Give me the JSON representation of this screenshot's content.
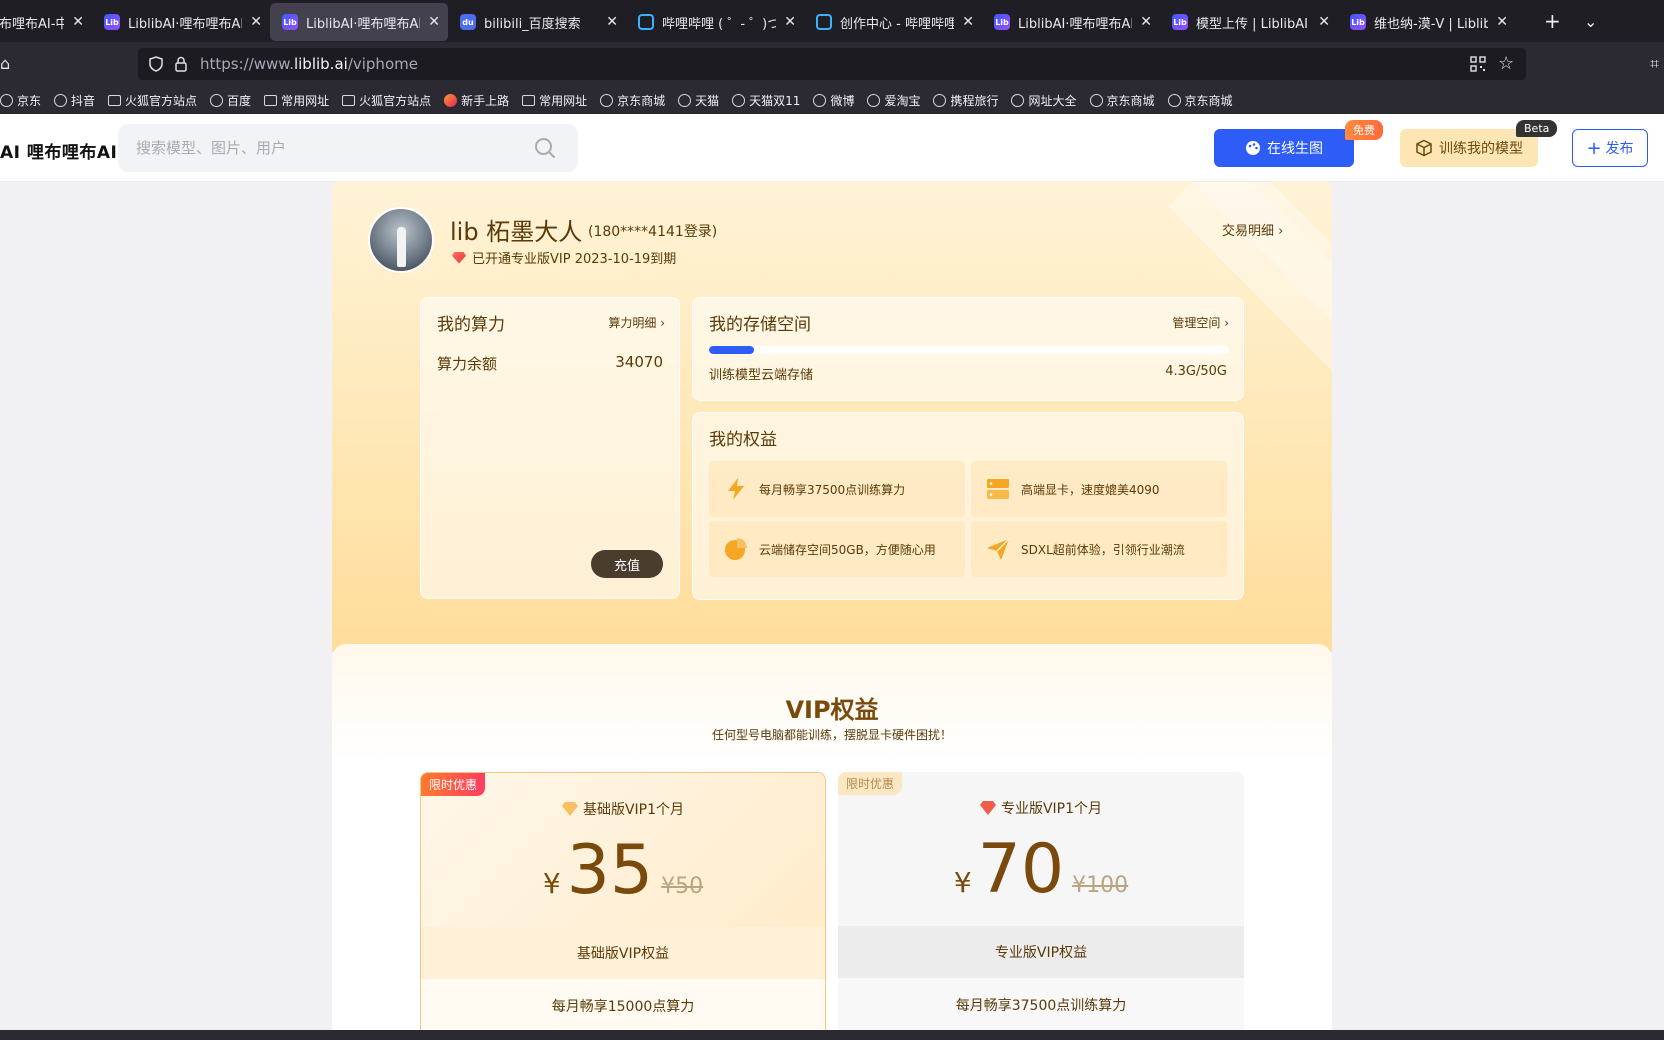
{
  "browser": {
    "tabs": [
      {
        "title": "哩布哩布AI-中",
        "icon": "liblib",
        "active": false
      },
      {
        "title": "LiblibAI·哩布哩布AI - 中",
        "icon": "liblib",
        "active": false
      },
      {
        "title": "LiblibAI·哩布哩布AI - 中",
        "icon": "liblib",
        "active": true
      },
      {
        "title": "bilibili_百度搜索",
        "icon": "baidu",
        "active": false
      },
      {
        "title": "哔哩哔哩 ( ゜- ゜)つロ 干",
        "icon": "bilibili",
        "active": false
      },
      {
        "title": "创作中心 - 哔哩哔哩弹",
        "icon": "bilibili",
        "active": false
      },
      {
        "title": "LiblibAI·哩布哩布AI - 中",
        "icon": "liblib",
        "active": false
      },
      {
        "title": "模型上传 | LiblibAI",
        "icon": "liblib",
        "active": false
      },
      {
        "title": "维也纳-漠-V | LiblibAI",
        "icon": "liblib",
        "active": false
      }
    ],
    "new_tab_symbol": "+",
    "tab_list_symbol": "⌄",
    "url": {
      "prefix": "https://www.",
      "domain": "liblib.ai",
      "path": "/viphome"
    },
    "bookmarks": [
      {
        "label": "京东",
        "icon": "globe"
      },
      {
        "label": "抖音",
        "icon": "globe"
      },
      {
        "label": "火狐官方站点",
        "icon": "folder"
      },
      {
        "label": "百度",
        "icon": "globe"
      },
      {
        "label": "常用网址",
        "icon": "folder"
      },
      {
        "label": "火狐官方站点",
        "icon": "folder"
      },
      {
        "label": "新手上路",
        "icon": "firefox"
      },
      {
        "label": "常用网址",
        "icon": "folder"
      },
      {
        "label": "京东商城",
        "icon": "globe"
      },
      {
        "label": "天猫",
        "icon": "globe"
      },
      {
        "label": "天猫双11",
        "icon": "globe"
      },
      {
        "label": "微博",
        "icon": "globe"
      },
      {
        "label": "爱淘宝",
        "icon": "globe"
      },
      {
        "label": "携程旅行",
        "icon": "globe"
      },
      {
        "label": "网址大全",
        "icon": "globe"
      },
      {
        "label": "京东商城",
        "icon": "globe"
      },
      {
        "label": "京东商城",
        "icon": "globe"
      }
    ]
  },
  "header": {
    "logo": "AI 哩布哩布AI",
    "search_placeholder": "搜索模型、图片、用户",
    "online_button": "在线生图",
    "free_badge": "免费",
    "train_button": "训练我的模型",
    "beta_badge": "Beta",
    "publish_button": "发布"
  },
  "profile": {
    "name": "lib 柘墨大人",
    "phone": "(180****4141登录)",
    "vip_status": "已开通专业版VIP  2023-10-19到期",
    "trade_link": "交易明细"
  },
  "compute": {
    "title": "我的算力",
    "link": "算力明细",
    "balance_label": "算力余额",
    "balance_value": "34070",
    "recharge": "充值"
  },
  "storage": {
    "title": "我的存储空间",
    "link": "管理空间",
    "label": "训练模型云端存储",
    "value": "4.3G/50G",
    "used_fraction": 0.086
  },
  "rights": {
    "title": "我的权益",
    "items": [
      {
        "text": "每月畅享37500点训练算力",
        "icon": "lightning-icon"
      },
      {
        "text": "高端显卡，速度媲美4090",
        "icon": "server-icon"
      },
      {
        "text": "云端储存空间50GB，方便随心用",
        "icon": "pie-chart-icon"
      },
      {
        "text": "SDXL超前体验，引领行业潮流",
        "icon": "paper-plane-icon"
      }
    ]
  },
  "vip_section": {
    "heading": "VIP权益",
    "subheading": "任何型号电脑都能训练，摆脱显卡硬件困扰！",
    "plans": [
      {
        "tag": "限时优惠",
        "name": "基础版VIP1个月",
        "currency": "¥",
        "price": "35",
        "original": "¥50",
        "band": "基础版VIP权益",
        "row1": "每月畅享15000点算力"
      },
      {
        "tag": "限时优惠",
        "name": "专业版VIP1个月",
        "currency": "¥",
        "price": "70",
        "original": "¥100",
        "band": "专业版VIP权益",
        "row1": "每月畅享37500点训练算力"
      }
    ]
  },
  "colors": {
    "accent": "#2d5cf6",
    "gold_text": "#5a3a06",
    "brown_price": "#7a4a0c"
  }
}
